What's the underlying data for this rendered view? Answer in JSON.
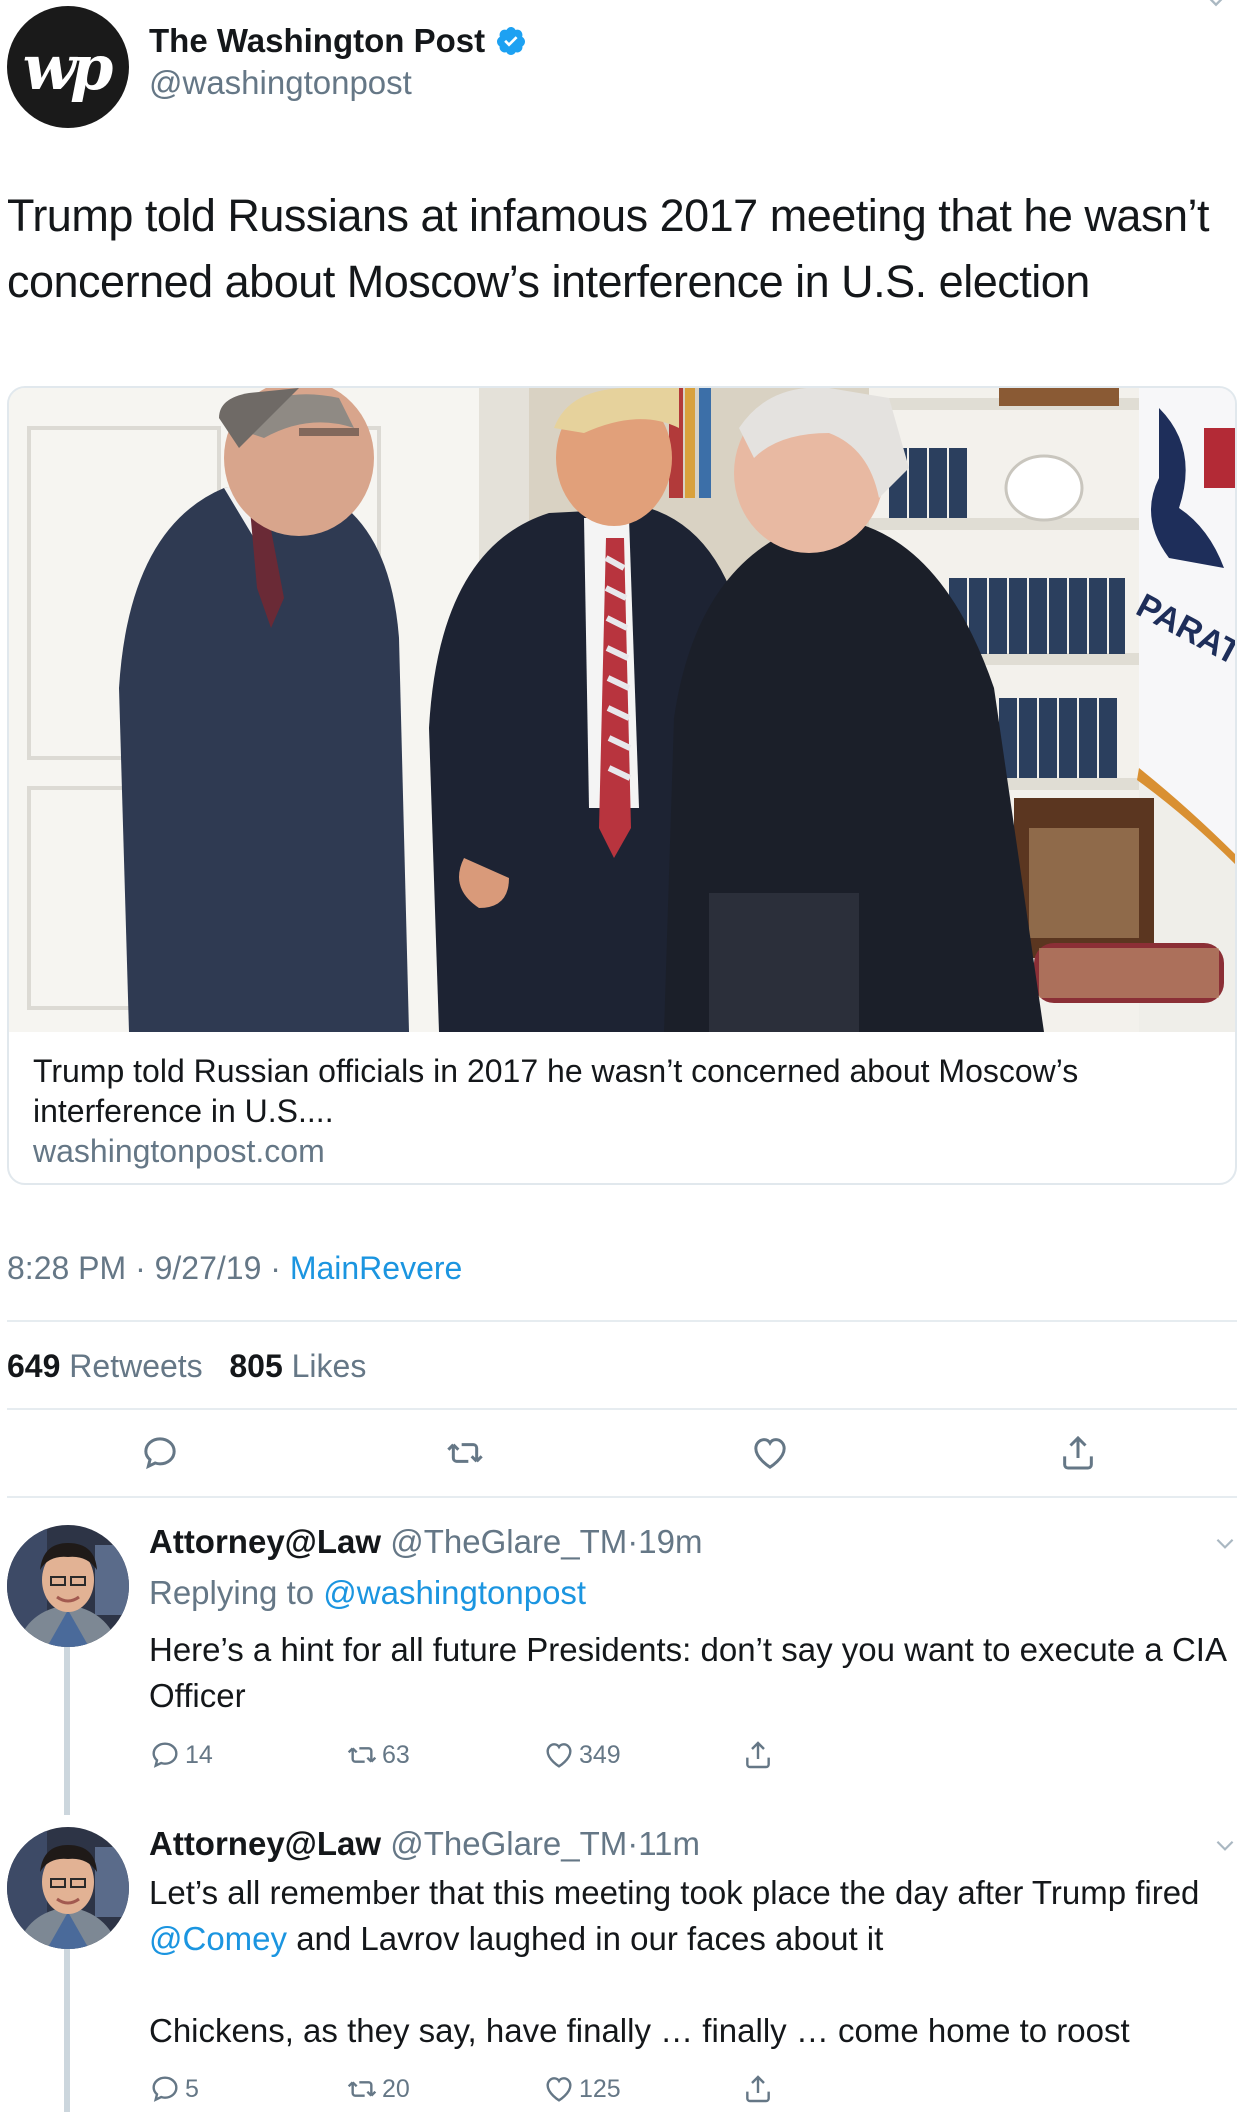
{
  "tweet": {
    "author_name": "The Washington Post",
    "author_handle": "@washingtonpost",
    "avatar_text": "wp",
    "text": "Trump told Russians at infamous 2017 meeting that he wasn’t concerned about Moscow’s interference in U.S. election",
    "card": {
      "title": "Trump told Russian officials in 2017 he wasn’t concerned about Moscow’s interference in U.S....",
      "domain": "washingtonpost.com",
      "flag_text": "PARATUS"
    },
    "time": "8:28 PM",
    "separator": "·",
    "date": "9/27/19",
    "source": "MainRevere",
    "retweets_count": "649",
    "retweets_label": "Retweets",
    "likes_count": "805",
    "likes_label": "Likes"
  },
  "replies": [
    {
      "name": "Attorney@Law",
      "handle": "@TheGlare_TM",
      "separator": "·",
      "time": "19m",
      "replying_prefix": "Replying to",
      "replying_to": "@washingtonpost",
      "text": "Here’s a hint for all future Presidents: don’t say you want to execute a CIA Officer",
      "reply_count": "14",
      "retweet_count": "63",
      "like_count": "349"
    },
    {
      "name": "Attorney@Law",
      "handle": "@TheGlare_TM",
      "separator": "·",
      "time": "11m",
      "text_part1": "Let’s all remember that this meeting took place the day after Trump fired",
      "mention": "@Comey",
      "text_part2": "and Lavrov laughed in our faces about it",
      "text_para2": "Chickens, as they say, have finally … finally … come home to roost",
      "reply_count": "5",
      "retweet_count": "20",
      "like_count": "125"
    }
  ],
  "colors": {
    "link": "#1b95e0",
    "secondary": "#657786",
    "divider": "#e6ecf0",
    "thread_line": "#ccd6dd"
  },
  "icons": [
    "verified-badge-icon",
    "reply-icon",
    "retweet-icon",
    "like-icon",
    "share-icon",
    "chevron-down-icon"
  ]
}
